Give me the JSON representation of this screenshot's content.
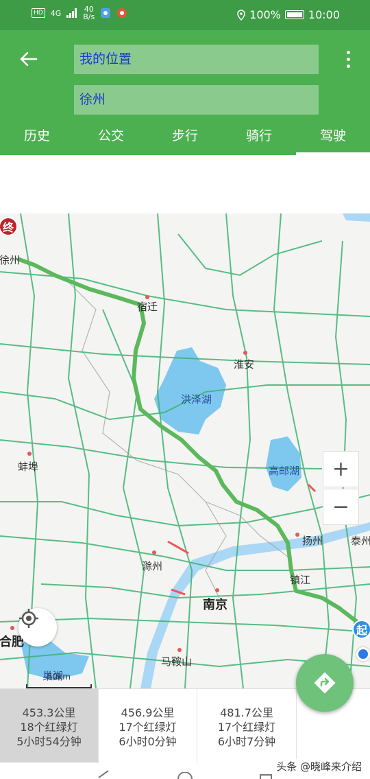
{
  "status_bar": {
    "hd": "HD",
    "signal": "4G",
    "speed_value": "40",
    "speed_unit": "B/s",
    "battery_percent": "100%",
    "time": "10:00"
  },
  "header": {
    "from_value": "我的位置",
    "to_value": "徐州"
  },
  "tabs": [
    {
      "label": "历史",
      "active": false
    },
    {
      "label": "公交",
      "active": false
    },
    {
      "label": "步行",
      "active": false
    },
    {
      "label": "骑行",
      "active": false
    },
    {
      "label": "驾驶",
      "active": true
    }
  ],
  "map": {
    "cities": {
      "xuzhou": "徐州",
      "suqian": "宿迁",
      "huaian": "淮安",
      "hongze_lake": "洪泽湖",
      "bengbu": "蚌埠",
      "gaoyou_lake": "高邮湖",
      "yangzhou": "扬州",
      "taizhou": "泰州",
      "chuzhou": "滁州",
      "zhenjiang": "镇江",
      "nanjing": "南京",
      "hefei": "合肥",
      "maanshan": "马鞍山",
      "chaohu": "巢湖"
    },
    "end_marker": "终",
    "start_marker": "起",
    "scale_label": "50km",
    "zoom_in": "+",
    "zoom_out": "−"
  },
  "routes": [
    {
      "distance": "453.3公里",
      "lights": "18个红绿灯",
      "time": "5小时54分钟",
      "selected": true
    },
    {
      "distance": "456.9公里",
      "lights": "17个红绿灯",
      "time": "6小时0分钟",
      "selected": false
    },
    {
      "distance": "481.7公里",
      "lights": "17个红绿灯",
      "time": "6小时7分钟",
      "selected": false
    }
  ],
  "watermark": "头条 @晓峰来介绍",
  "colors": {
    "status_bar": "#3d9c45",
    "header": "#4caf50",
    "route_line": "#5cb85c",
    "road": "#3cb371",
    "lake": "#7ec8f0",
    "fab": "#6ec27a"
  }
}
